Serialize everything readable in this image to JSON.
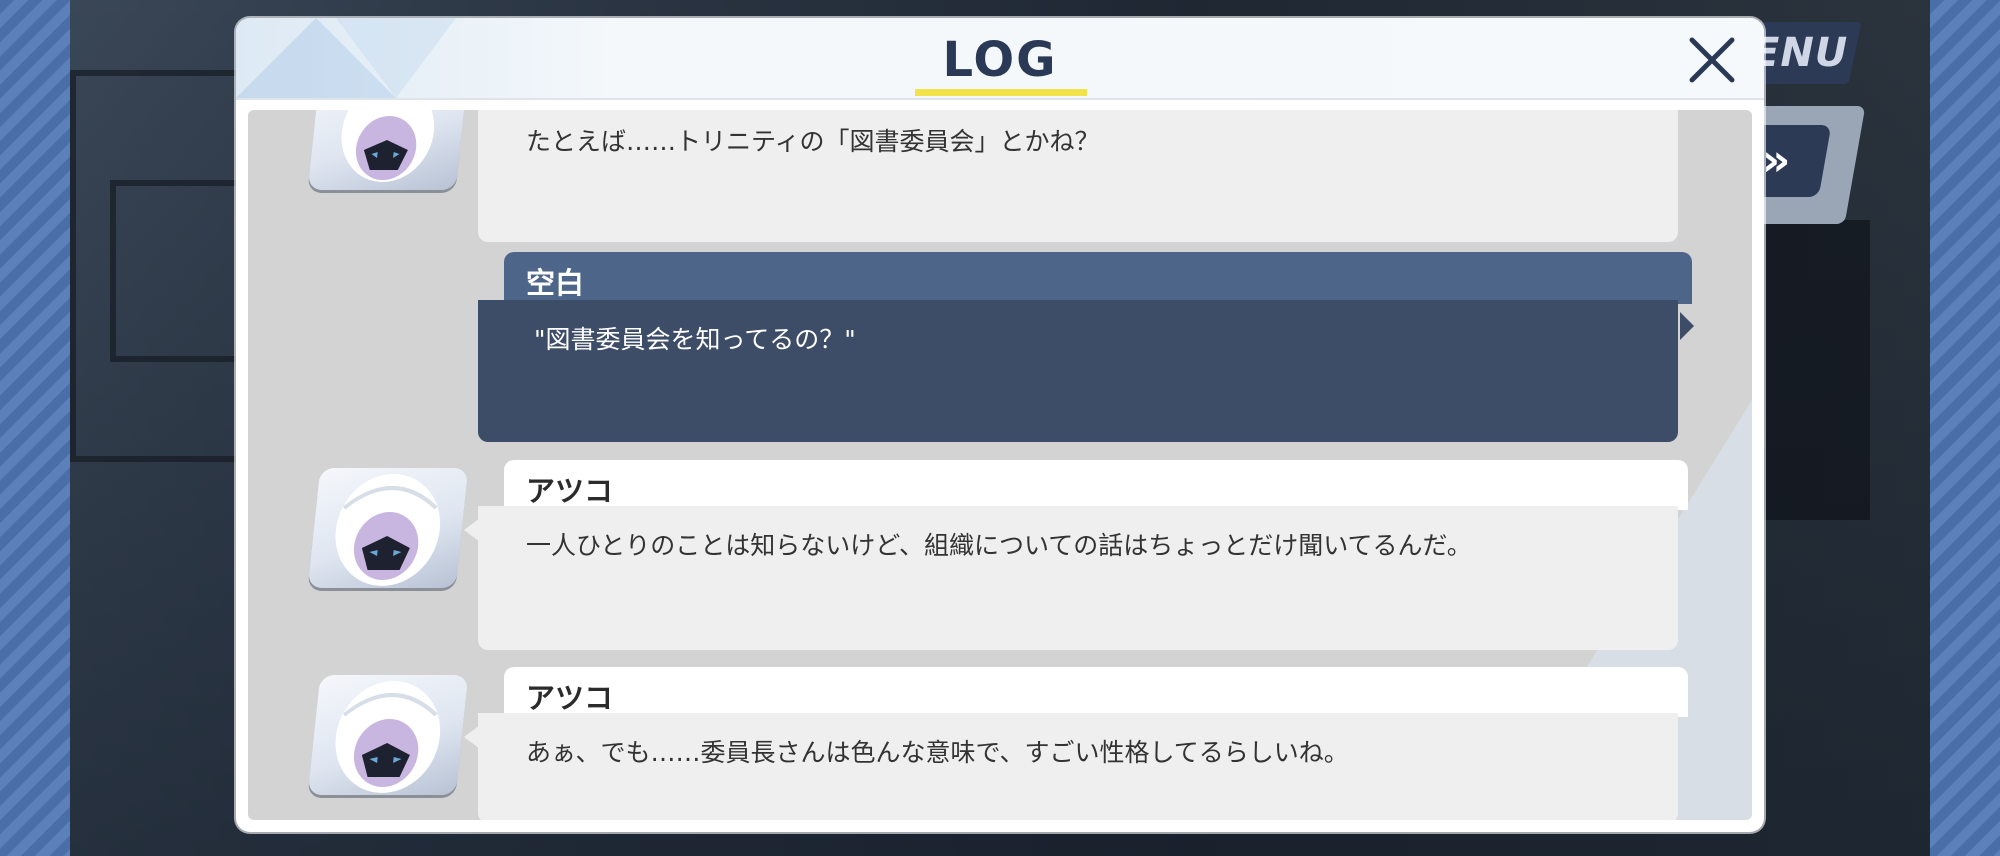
{
  "header": {
    "menu_label": "ENU",
    "fast_forward_icon": "fast-forward-icon"
  },
  "log": {
    "title": "LOG",
    "close_icon": "close-icon",
    "entries": [
      {
        "speaker": "",
        "text": "たとえば……トリニティの「図書委員会」とかね？",
        "is_player": false
      },
      {
        "speaker": "空白",
        "text": "\"図書委員会を知ってるの？\"",
        "is_player": true
      },
      {
        "speaker": "アツコ",
        "text": "一人ひとりのことは知らないけど、組織についての話はちょっとだけ聞いてるんだ。",
        "is_player": false
      },
      {
        "speaker": "アツコ",
        "text": "あぁ、でも……委員長さんは色んな意味で、すごい性格してるらしいね。",
        "is_player": false
      }
    ]
  },
  "colors": {
    "accent_underline": "#f2e34a",
    "player_bubble": "#3d4c67",
    "player_name_bar": "#4d6589",
    "npc_bubble": "#efefef"
  }
}
